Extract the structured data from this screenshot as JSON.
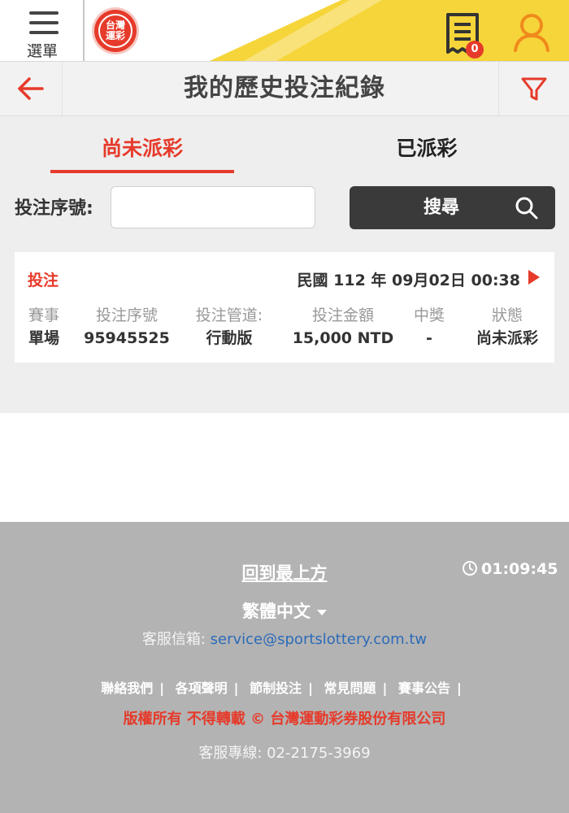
{
  "topbar": {
    "menu_label": "選單",
    "logo_line1": "台灣",
    "logo_line2": "運彩",
    "cart_count": "0"
  },
  "header": {
    "title": "我的歷史投注紀錄"
  },
  "tabs": [
    {
      "label": "尚未派彩",
      "active": true
    },
    {
      "label": "已派彩",
      "active": false
    }
  ],
  "search": {
    "label": "投注序號:",
    "value": "",
    "placeholder": "",
    "button_label": "搜尋"
  },
  "record": {
    "type": "投注",
    "datetime": "民國 112 年 09月02日 00:38",
    "columns": [
      {
        "header": "賽事",
        "value": "單場"
      },
      {
        "header": "投注序號",
        "value": "95945525"
      },
      {
        "header": "投注管道:",
        "value": "行動版"
      },
      {
        "header": "投注金額",
        "value": "15,000 NTD"
      },
      {
        "header": "中獎",
        "value": "-"
      },
      {
        "header": "狀態",
        "value": "尚未派彩"
      }
    ]
  },
  "footer": {
    "back_to_top": "回到最上方",
    "time": "01:09:45",
    "language": "繁體中文",
    "email_label": "客服信箱: ",
    "email": "service@sportslottery.com.tw",
    "links": [
      "聯絡我們",
      "各項聲明",
      "節制投注",
      "常見問題",
      "賽事公告"
    ],
    "copyright": "版權所有 不得轉載 © 台灣運動彩券股份有限公司",
    "hotline": "客服專線: 02-2175-3969"
  },
  "colors": {
    "accent": "#e63a2a",
    "brand_yellow": "#f6d53a",
    "footer_bg": "#b3b3b3",
    "button_dark": "#3a3a3a"
  }
}
